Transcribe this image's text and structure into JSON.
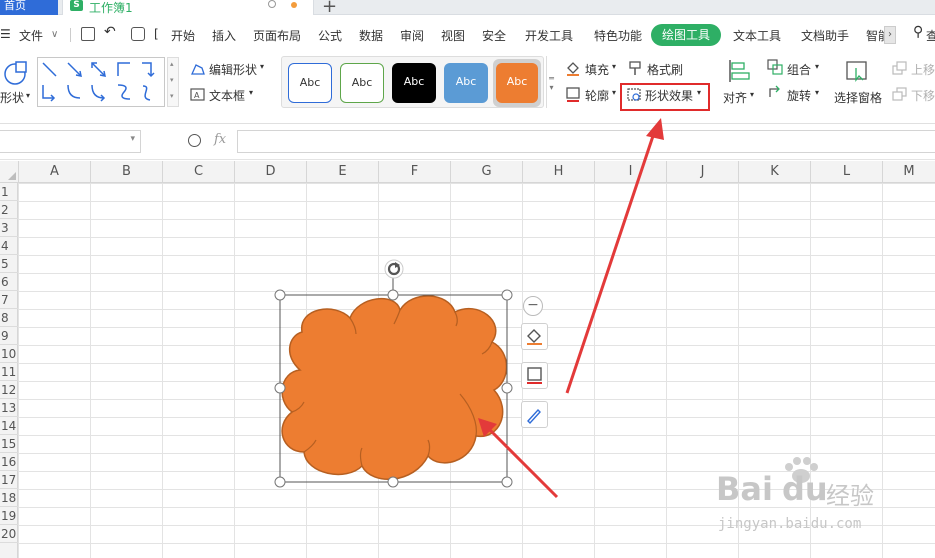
{
  "tabs": {
    "home": "首页",
    "workbook": "工作簿1",
    "new_tab": "+"
  },
  "menu": {
    "file": "文件",
    "items": [
      "开始",
      "插入",
      "页面布局",
      "公式",
      "数据",
      "审阅",
      "视图",
      "安全",
      "开发工具",
      "特色功能"
    ],
    "active": "绘图工具",
    "after": [
      "文本工具",
      "文档助手",
      "智能"
    ],
    "search_partial": "查"
  },
  "ribbon": {
    "shape_label": "形状",
    "edit_shape": "编辑形状",
    "text_box": "文本框",
    "style_samples": [
      "Abc",
      "Abc",
      "Abc",
      "Abc",
      "Abc"
    ],
    "fill": "填充",
    "format_painter": "格式刷",
    "outline": "轮廓",
    "shape_effects": "形状效果",
    "align": "对齐",
    "group": "组合",
    "rotate": "旋转",
    "selection_pane": "选择窗格",
    "bring_forward": "上移",
    "send_backward": "下移"
  },
  "formula": {
    "fx": "fx",
    "name_box": "",
    "content": ""
  },
  "grid": {
    "columns": [
      "A",
      "B",
      "C",
      "D",
      "E",
      "F",
      "G",
      "H",
      "I",
      "J",
      "K",
      "L",
      "M"
    ],
    "rows": [
      "1",
      "2",
      "3",
      "4",
      "5",
      "6",
      "7",
      "8",
      "9",
      "10",
      "11",
      "12",
      "13",
      "14",
      "15",
      "16",
      "17",
      "18",
      "19",
      "20"
    ]
  },
  "colors": {
    "accent_green": "#2eaf65",
    "wps_blue": "#2f6cd8",
    "shape_fill": "#ed7d31",
    "shape_outline": "#b65f21",
    "highlight_red": "#e02b2b",
    "arrow_red": "#e33a3a"
  },
  "icons": [
    "menu-icon",
    "save-icon",
    "undo-icon",
    "print-icon",
    "rotate-handle-icon",
    "collapse-icon",
    "fill-icon",
    "outline-icon",
    "brush-icon",
    "zoom-icon",
    "search-icon"
  ],
  "watermark": {
    "brand": "Bai",
    "du": "du",
    "jingyan": "经验",
    "url": "jingyan.baidu.com"
  }
}
